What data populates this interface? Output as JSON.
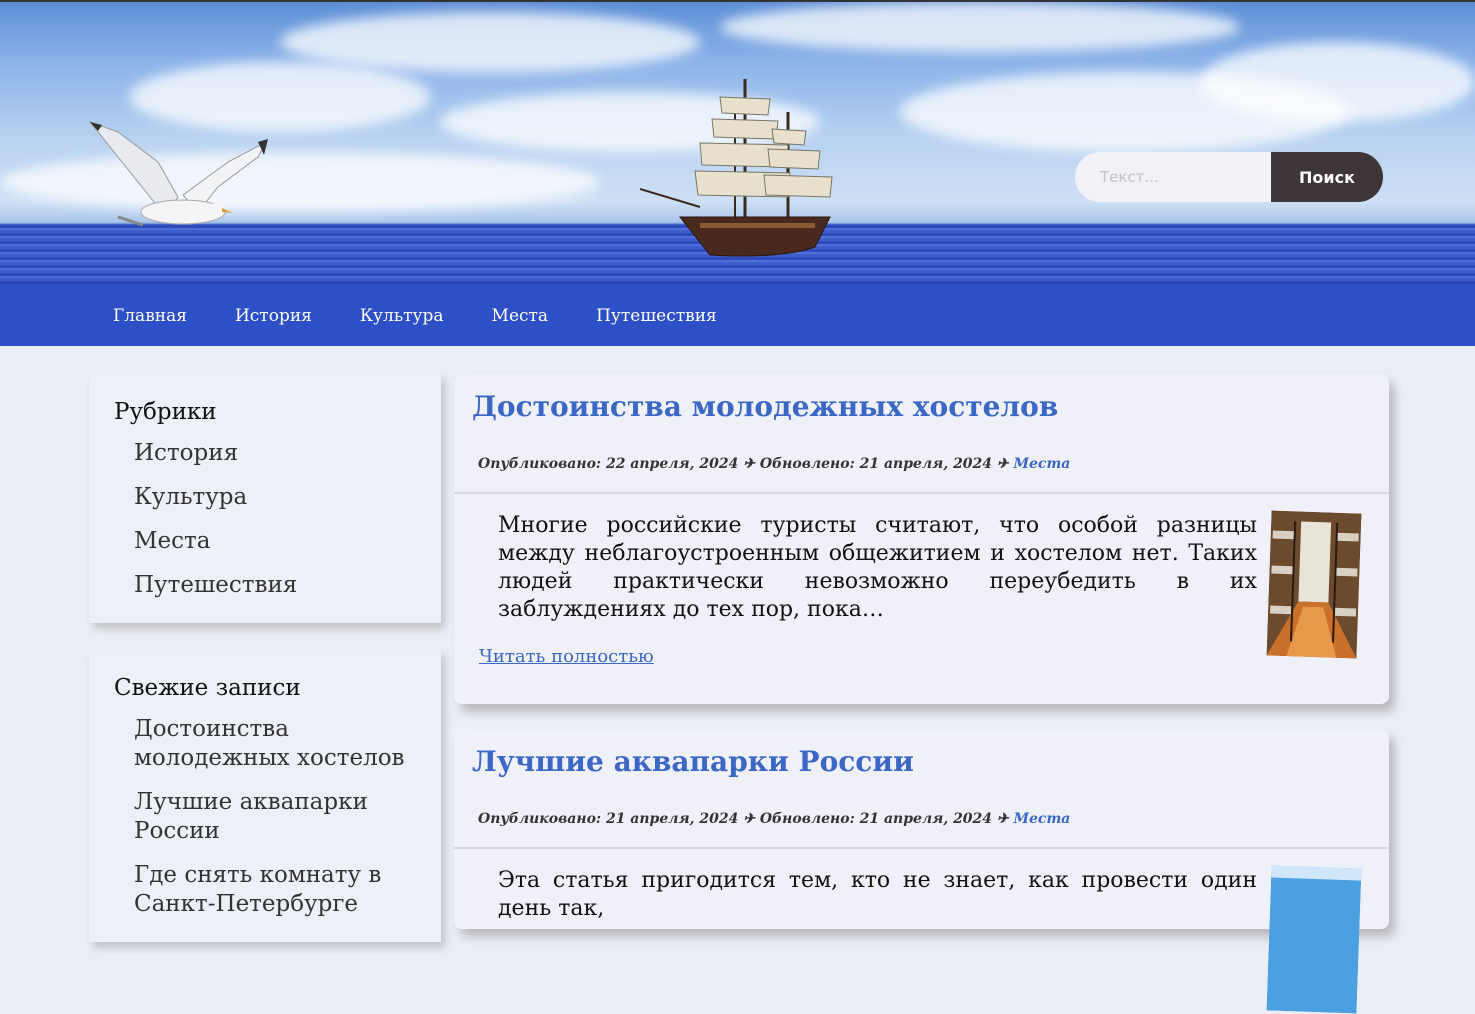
{
  "search": {
    "placeholder": "Текст...",
    "button_label": "Поиск"
  },
  "nav": {
    "items": [
      "Главная",
      "История",
      "Культура",
      "Места",
      "Путешествия"
    ]
  },
  "sidebar": {
    "categories": {
      "title": "Рубрики",
      "items": [
        "История",
        "Культура",
        "Места",
        "Путешествия"
      ]
    },
    "recent": {
      "title": "Свежие записи",
      "items": [
        "Достоинства молодежных хостелов",
        "Лучшие аквапарки России",
        "Где снять комнату в Санкт-Петербурге"
      ]
    }
  },
  "posts": [
    {
      "title": "Достоинства молодежных хостелов",
      "published": "Опубликовано: 22 апреля, 2024",
      "updated": "Обновлено: 21 апреля, 2024",
      "category": "Места",
      "excerpt": "Многие российские туристы считают, что особой разницы между неблагоустроенным общежитием и хостелом нет. Таких людей практически невозможно переубедить в их заблуждениях до тех пор, пока…",
      "read_more": "Читать полностью"
    },
    {
      "title": "Лучшие аквапарки России",
      "published": "Опубликовано: 21 апреля, 2024",
      "updated": "Обновлено: 21 апреля, 2024",
      "category": "Места",
      "excerpt": "Эта статья пригодится тем, кто не знает, как провести один день так,"
    }
  ],
  "meta_separator": "✈"
}
